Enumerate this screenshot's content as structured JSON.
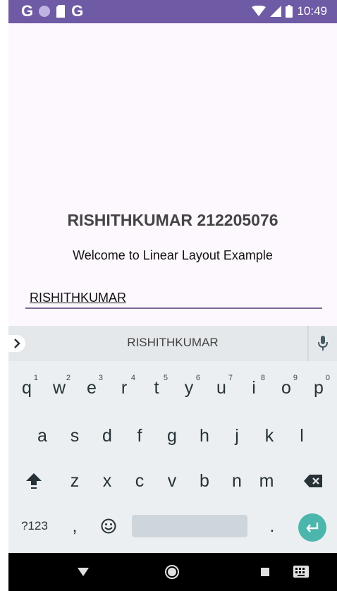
{
  "status_bar": {
    "left_icons": [
      "G",
      "circle-icon",
      "sd-card-icon",
      "G"
    ],
    "time": "10:49",
    "right_icons": [
      "wifi-icon",
      "signal-icon",
      "battery-icon"
    ]
  },
  "app": {
    "title": "RISHITHKUMAR 212205076",
    "subtitle": "Welcome to Linear Layout Example",
    "edit_text_value": "RISHITHKUMAR"
  },
  "keyboard": {
    "suggestion": "RISHITHKUMAR",
    "row1": [
      {
        "label": "q",
        "hint": "1"
      },
      {
        "label": "w",
        "hint": "2"
      },
      {
        "label": "e",
        "hint": "3"
      },
      {
        "label": "r",
        "hint": "4"
      },
      {
        "label": "t",
        "hint": "5"
      },
      {
        "label": "y",
        "hint": "6"
      },
      {
        "label": "u",
        "hint": "7"
      },
      {
        "label": "i",
        "hint": "8"
      },
      {
        "label": "o",
        "hint": "9"
      },
      {
        "label": "p",
        "hint": "0"
      }
    ],
    "row2": [
      "a",
      "s",
      "d",
      "f",
      "g",
      "h",
      "j",
      "k",
      "l"
    ],
    "row3": [
      "z",
      "x",
      "c",
      "v",
      "b",
      "n",
      "m"
    ],
    "symbols_label": "?123",
    "comma_label": ",",
    "period_label": ".",
    "accent_color": "#4db6ac"
  },
  "colors": {
    "status_bar": "#6f5aa5",
    "background": "#fdf7fe",
    "underline": "#7b6a92"
  }
}
